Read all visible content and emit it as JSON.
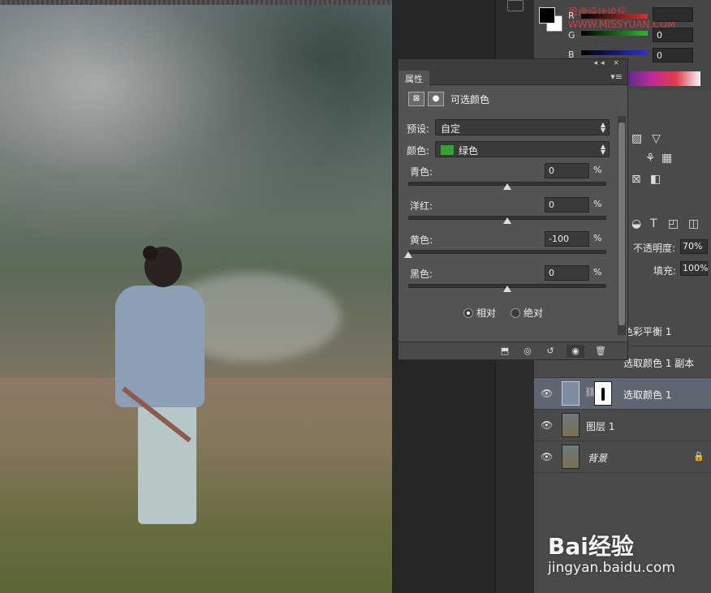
{
  "color_panel": {
    "fg_color": "#000000",
    "bg_color": "#ffffff",
    "channels": [
      {
        "name": "R",
        "value": "",
        "bar_color": "#e03030"
      },
      {
        "name": "G",
        "value": "0",
        "bar_color": "#2fb82f"
      },
      {
        "name": "B",
        "value": "0",
        "bar_color": "#2f2fd8"
      }
    ],
    "watermark": "思缘设计论坛 WWW.MISSYUAN.COM"
  },
  "properties": {
    "panel_collapse": "◂◂",
    "panel_close": "×",
    "tab_label": "属性",
    "menu_icon": "▾≡",
    "adjustment_icon": "selective-color-icon",
    "mask_icon": "mask-icon",
    "title": "可选颜色",
    "preset_label": "预设:",
    "preset_value": "自定",
    "colors_label": "颜色:",
    "colors_value": "绿色",
    "colors_swatch": "#33a332",
    "sliders": [
      {
        "label": "青色:",
        "value": "0",
        "unit": "%",
        "level": 0
      },
      {
        "label": "洋红:",
        "value": "0",
        "unit": "%",
        "level": 0
      },
      {
        "label": "黄色:",
        "value": "-100",
        "unit": "%",
        "level": -100
      },
      {
        "label": "黑色:",
        "value": "0",
        "unit": "%",
        "level": 0
      }
    ],
    "method": {
      "relative_label": "相对",
      "absolute_label": "绝对",
      "selected": "relative"
    }
  },
  "layers_panel": {
    "opacity_label": "不透明度:",
    "opacity_value": "70%",
    "fill_label": "填充:",
    "fill_value": "100%",
    "layers": [
      {
        "name": "色彩平衡 1",
        "type": "adjustment"
      },
      {
        "name": "选取颜色 1 副本",
        "type": "adjustment"
      },
      {
        "name": "选取颜色 1",
        "type": "adjustment",
        "selected": true
      },
      {
        "name": "图层 1",
        "type": "pixel"
      },
      {
        "name": "背景",
        "type": "background",
        "locked": true
      }
    ]
  },
  "watermark": {
    "brand": "Bai经验",
    "url": "jingyan.baidu.com"
  }
}
